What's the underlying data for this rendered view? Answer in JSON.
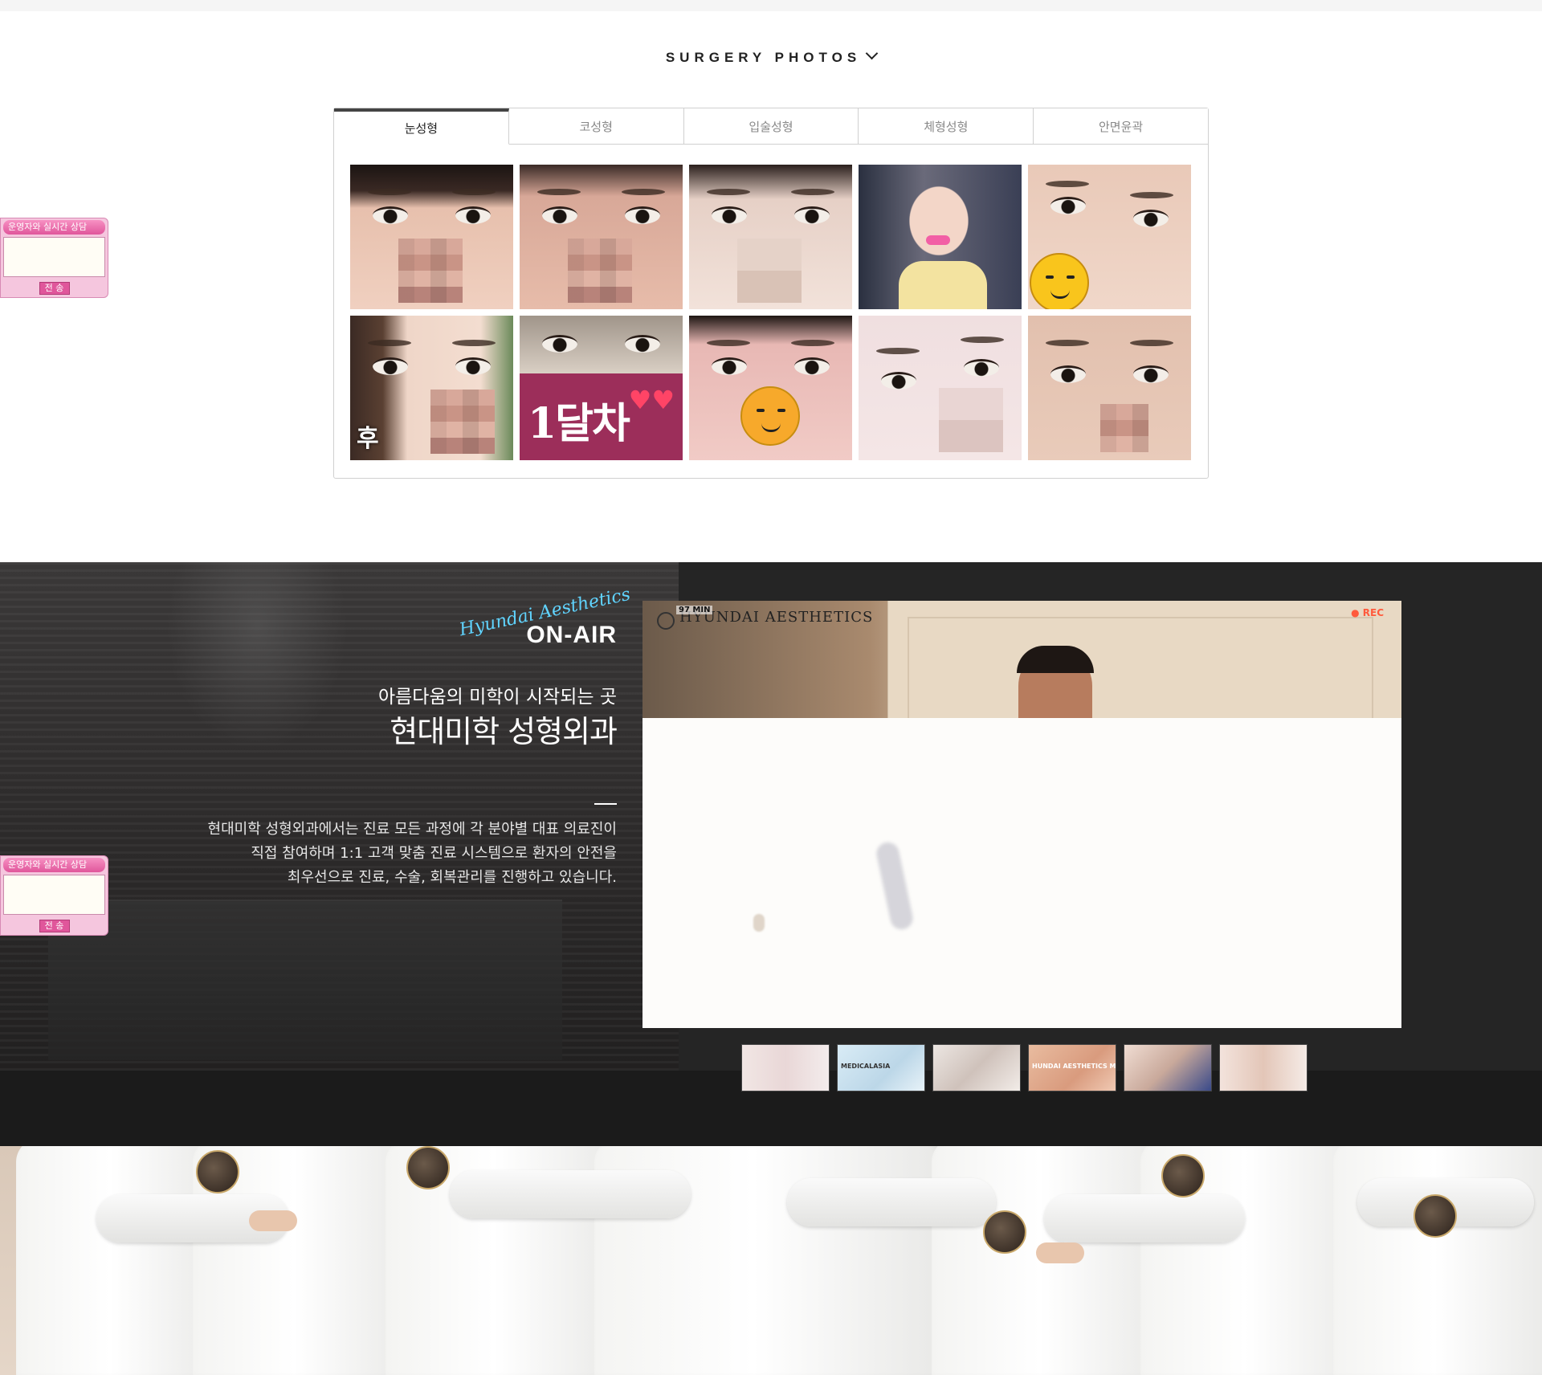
{
  "surgery_photos": {
    "title": "SURGERY PHOTOS",
    "tabs": [
      "눈성형",
      "코성형",
      "입술성형",
      "체형성형",
      "안면윤곽"
    ],
    "active_tab": 0,
    "photos": [
      {
        "overlay": ""
      },
      {
        "overlay": ""
      },
      {
        "overlay": ""
      },
      {
        "overlay": ""
      },
      {
        "overlay": ""
      },
      {
        "overlay": "후"
      },
      {
        "overlay": "1달차"
      },
      {
        "overlay": ""
      },
      {
        "overlay": ""
      },
      {
        "overlay": ""
      }
    ]
  },
  "chat_widget": {
    "header": "운영자와 실시간 상담",
    "send_label": "전 송"
  },
  "onair": {
    "script_text": "Hyundai Aesthetics",
    "title": "ON-AIR",
    "subtitle_small": "아름다움의 미학이 시작되는 곳",
    "subtitle_large": "현대미학 성형외과",
    "description": [
      "현대미학 성형외과에서는 진료 모든 과정에 각 분야별 대표 의료진이",
      "직접 참여하며 1:1 고객 맞춤 진료 시스템으로 환자의 안전을",
      "최우선으로 진료, 수술, 회복관리를 진행하고 있습니다."
    ],
    "video": {
      "logo_text": "HYUNDAI AESTHETICS",
      "tag": "97 MIN",
      "rec_label": "REC"
    },
    "thumbnails": [
      {
        "caption": ""
      },
      {
        "caption": "MEDICALASIA"
      },
      {
        "caption": ""
      },
      {
        "caption": "HUNDAI AESTHETICS MAKING FILM"
      },
      {
        "caption": ""
      },
      {
        "caption": ""
      }
    ]
  },
  "colors": {
    "onair_bg": "#252525",
    "script_accent": "#60d4ff",
    "chat_pink": "#e0569b"
  }
}
